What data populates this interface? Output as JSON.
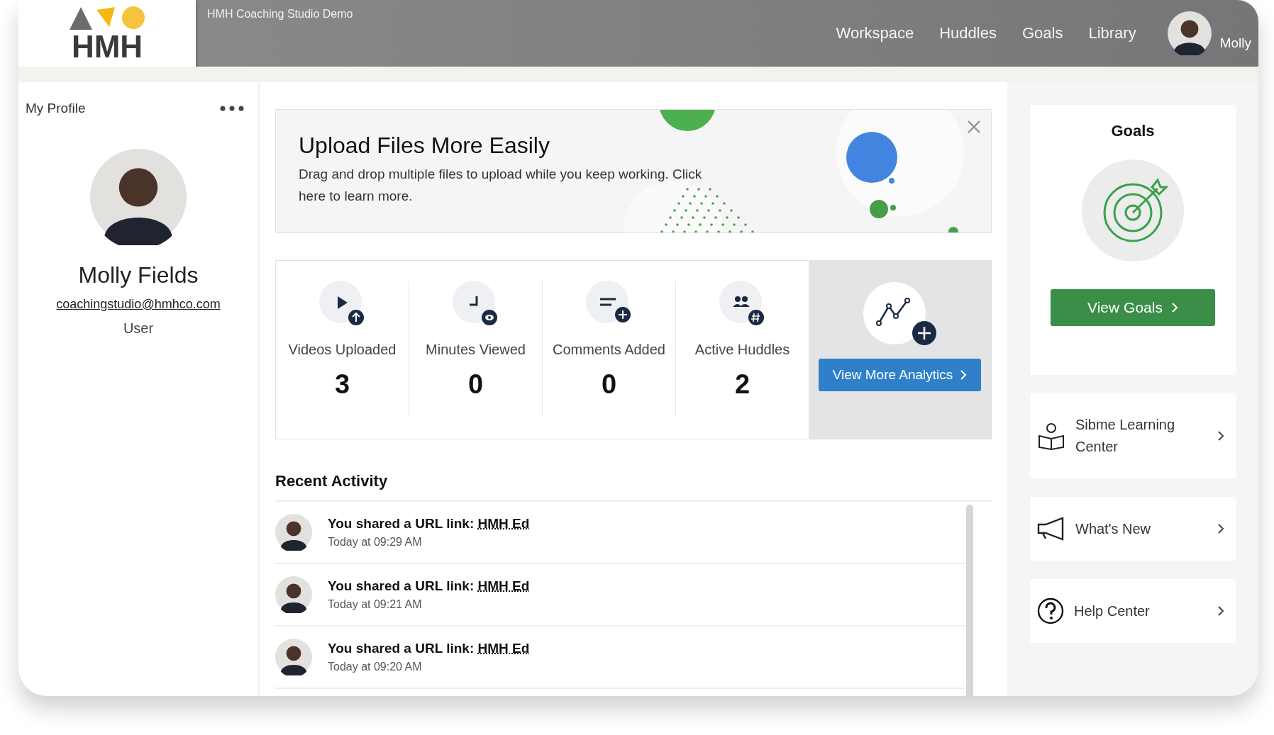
{
  "header": {
    "brand": "HMH",
    "app_title": "HMH Coaching Studio Demo",
    "nav": [
      {
        "label": "Workspace"
      },
      {
        "label": "Huddles"
      },
      {
        "label": "Goals"
      },
      {
        "label": "Library"
      }
    ],
    "user": "Molly"
  },
  "profile": {
    "title": "My Profile",
    "name": "Molly Fields",
    "email": "coachingstudio@hmhco.com",
    "role": "User"
  },
  "banner": {
    "title": "Upload Files More Easily",
    "text": "Drag and drop multiple files to upload while you keep working. Click here to learn more."
  },
  "stats": [
    {
      "kind": "video",
      "label": "Videos Uploaded",
      "value": "3"
    },
    {
      "kind": "minutes",
      "label": "Minutes Viewed",
      "value": "0"
    },
    {
      "kind": "comments",
      "label": "Comments Added",
      "value": "0"
    },
    {
      "kind": "huddles",
      "label": "Active Huddles",
      "value": "2"
    }
  ],
  "analytics_button": "View More Analytics",
  "activity": {
    "title": "Recent Activity",
    "items": [
      {
        "text": "You shared a URL link:",
        "link": "HMH Ed",
        "time": "Today at 09:29 AM"
      },
      {
        "text": "You shared a URL link:",
        "link": "HMH Ed",
        "time": "Today at 09:21 AM"
      },
      {
        "text": "You shared a URL link:",
        "link": "HMH Ed",
        "time": "Today at 09:20 AM"
      }
    ]
  },
  "goals": {
    "title": "Goals",
    "button": "View Goals"
  },
  "resources": [
    {
      "kind": "learning",
      "label": "Sibme Learning Center"
    },
    {
      "kind": "news",
      "label": "What's New"
    },
    {
      "kind": "help",
      "label": "Help Center"
    }
  ]
}
